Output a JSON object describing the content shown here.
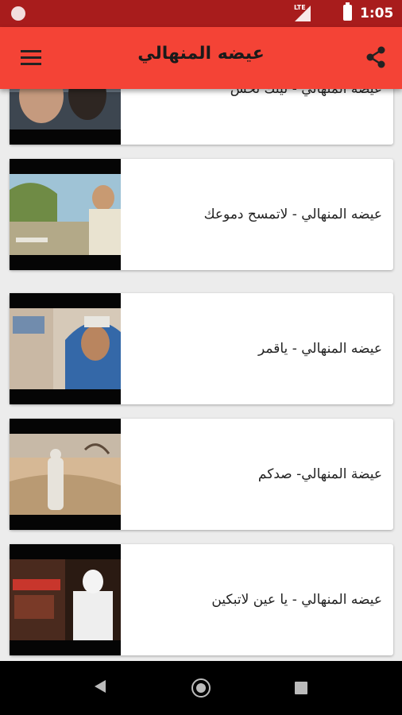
{
  "status_bar": {
    "network": "LTE",
    "time": "1:05"
  },
  "app_bar": {
    "title": "عيضه المنهالي"
  },
  "videos": [
    {
      "title": "عيضه المنهالي - ليتك تحس"
    },
    {
      "title": "عيضه المنهالي - لاتمسح دموعك"
    },
    {
      "title": "عيضه المنهالي - ياقمر"
    },
    {
      "title": "عيضة المنهالي- صدكم"
    },
    {
      "title": "عيضه المنهالي - يا عين لاتبكين"
    }
  ],
  "colors": {
    "primary": "#f44336",
    "status_bar": "#a81c1c",
    "background": "#ececec"
  },
  "icons": {
    "menu": "hamburger-menu-icon",
    "share": "share-icon",
    "back": "back-triangle-icon",
    "home": "home-circle-icon",
    "recents": "recents-square-icon"
  }
}
